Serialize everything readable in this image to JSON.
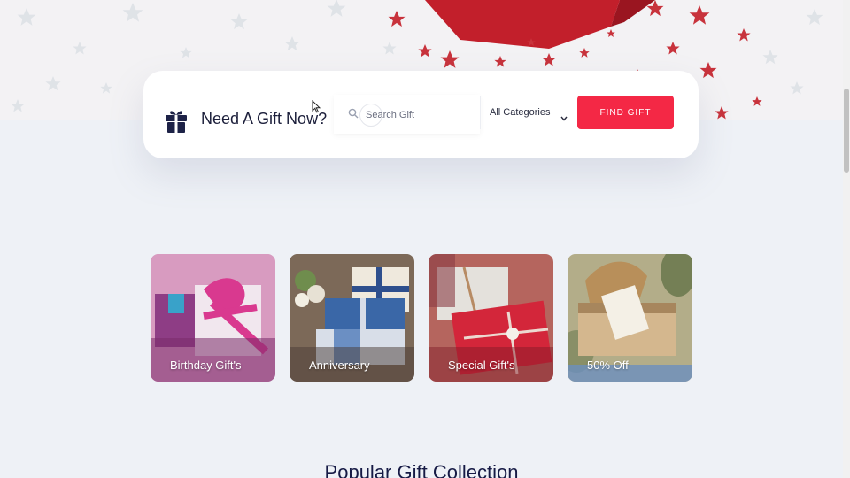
{
  "search": {
    "title": "Need A Gift Now?",
    "placeholder": "Search Gift",
    "category_selected": "All Categories",
    "find_label": "FIND GIFT"
  },
  "categories": [
    {
      "label": "Birthday Gift's"
    },
    {
      "label": "Anniversary"
    },
    {
      "label": "Special Gift's"
    },
    {
      "label": "50% Off"
    }
  ],
  "section": {
    "title": "Popular Gift Collection"
  },
  "icons": {
    "gift": "gift-icon",
    "search": "search-icon",
    "chevron": "chevron-down-icon"
  },
  "colors": {
    "accent": "#f42845",
    "heading": "#1c1f3b",
    "background": "#eef1f6"
  }
}
